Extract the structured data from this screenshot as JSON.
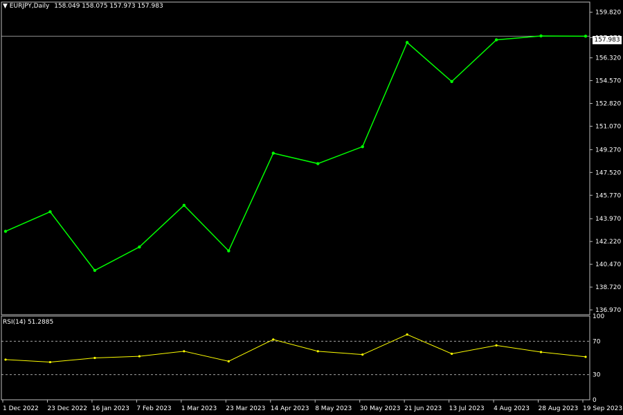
{
  "header": {
    "dropdown_icon": "triangle-down-icon",
    "symbol": "EURJPY,Daily",
    "ohlc": "158.049 158.075 157.973 157.983"
  },
  "current_price": "157.983",
  "indicator": {
    "label": "RSI(14) 51.2885",
    "levels": [
      "100",
      "70",
      "30",
      "0"
    ]
  },
  "colors": {
    "background": "#000000",
    "candle": "#00ff00",
    "bollinger": "#ff8c1a",
    "ma": "#ffffff",
    "rsi": "#ffff00",
    "grid": "#c0c0c0"
  },
  "chart_data": {
    "type": "line",
    "title": "EURJPY,Daily",
    "price_axis_ticks": [
      "159.820",
      "157.870",
      "156.320",
      "154.570",
      "152.820",
      "151.070",
      "149.270",
      "147.520",
      "145.770",
      "143.970",
      "142.220",
      "140.470",
      "138.720",
      "136.970"
    ],
    "ylim": [
      136.6,
      160.6
    ],
    "date_ticks": [
      "1 Dec 2022",
      "23 Dec 2022",
      "16 Jan 2023",
      "7 Feb 2023",
      "1 Mar 2023",
      "23 Mar 2023",
      "14 Apr 2023",
      "8 May 2023",
      "30 May 2023",
      "21 Jun 2023",
      "13 Jul 2023",
      "4 Aug 2023",
      "28 Aug 2023",
      "19 Sep 2023"
    ],
    "series": [
      {
        "name": "EURJPY",
        "dates": [
          "1 Dec 2022",
          "23 Dec 2022",
          "16 Jan 2023",
          "7 Feb 2023",
          "1 Mar 2023",
          "23 Mar 2023",
          "14 Apr 2023",
          "8 May 2023",
          "30 May 2023",
          "21 Jun 2023",
          "13 Jul 2023",
          "4 Aug 2023",
          "28 Aug 2023",
          "19 Sep 2023"
        ],
        "values": [
          143.0,
          144.5,
          140.0,
          141.8,
          145.0,
          141.5,
          149.0,
          148.2,
          149.5,
          157.5,
          154.5,
          157.7,
          158.0,
          157.98
        ]
      }
    ],
    "rsi": {
      "name": "RSI(14)",
      "levels": [
        70,
        30
      ],
      "ylim": [
        0,
        100
      ],
      "dates": [
        "1 Dec 2022",
        "23 Dec 2022",
        "16 Jan 2023",
        "7 Feb 2023",
        "1 Mar 2023",
        "23 Mar 2023",
        "14 Apr 2023",
        "8 May 2023",
        "30 May 2023",
        "21 Jun 2023",
        "13 Jul 2023",
        "4 Aug 2023",
        "28 Aug 2023",
        "19 Sep 2023"
      ],
      "values": [
        48,
        45,
        50,
        52,
        58,
        46,
        72,
        58,
        54,
        78,
        55,
        65,
        57,
        51.3
      ]
    }
  }
}
